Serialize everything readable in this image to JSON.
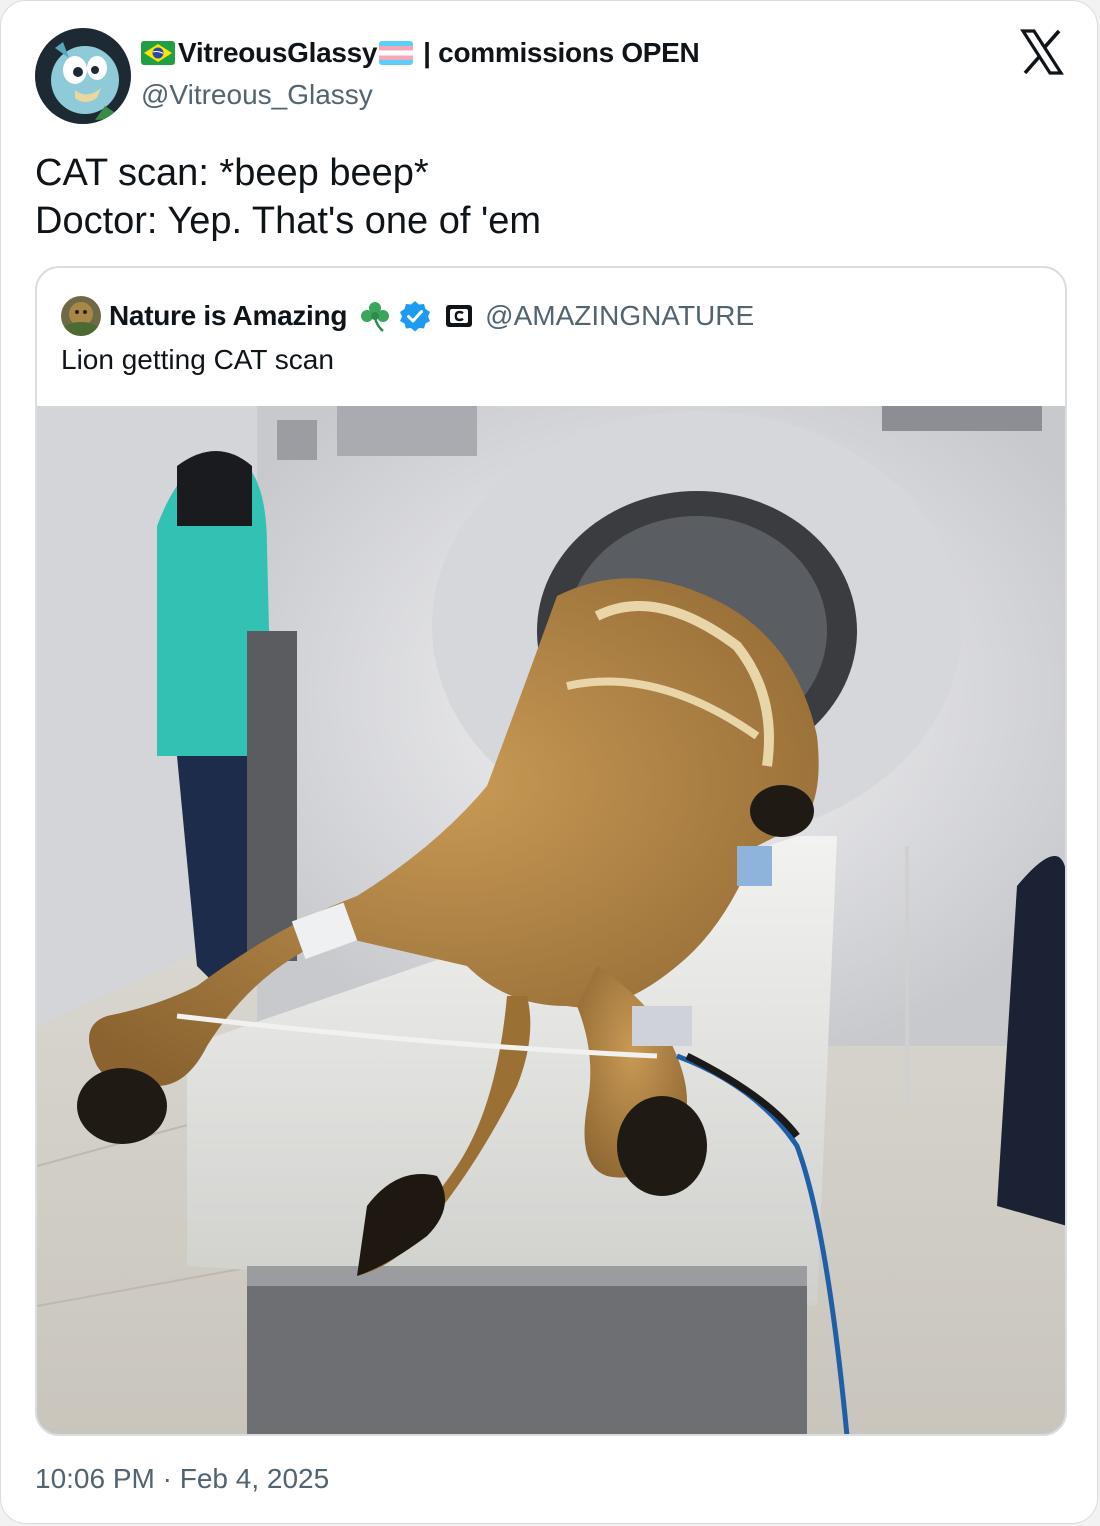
{
  "author": {
    "display_name": "VitreousGlassy",
    "tagline": "| commissions OPEN",
    "handle": "@Vitreous_Glassy",
    "avatar_icon": "cartoon-bird-avatar",
    "flags": [
      "brazil-flag-icon",
      "transgender-flag-icon"
    ]
  },
  "platform_icon": "x-logo-icon",
  "tweet": {
    "lines": [
      "CAT scan: *beep beep*",
      "Doctor: Yep. That's one of 'em"
    ]
  },
  "quoted": {
    "display_name": "Nature is Amazing",
    "handle": "@AMAZINGNATURE",
    "text": "Lion getting CAT scan",
    "badges": [
      "shamrock-icon",
      "verified-badge-icon",
      "c-square-icon"
    ],
    "image_icon": "lion-in-ct-scanner-photo"
  },
  "timestamp": "10:06 PM · Feb 4, 2025",
  "colors": {
    "text": "#0f1419",
    "secondary": "#536471",
    "border": "#d9dde1",
    "verified": "#1d9bf0",
    "shamrock": "#3ba55d"
  }
}
